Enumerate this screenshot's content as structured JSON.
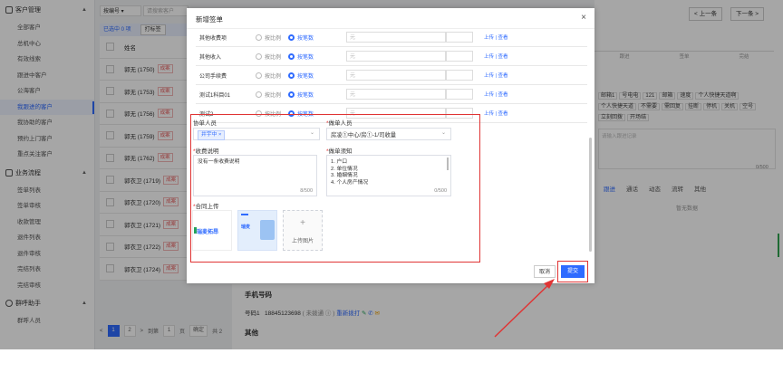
{
  "sidebar": {
    "group1": {
      "label": "客户管理"
    },
    "items1": [
      {
        "label": "全部客户"
      },
      {
        "label": "总机中心"
      },
      {
        "label": "有效线索"
      },
      {
        "label": "跟进中客户"
      },
      {
        "label": "公海客户"
      },
      {
        "label": "我跟进的客户"
      },
      {
        "label": "我协助的客户"
      },
      {
        "label": "预约上门客户"
      },
      {
        "label": "重点关注客户"
      }
    ],
    "group2": {
      "label": "业务流程"
    },
    "items2": [
      {
        "label": "签单列表"
      },
      {
        "label": "签单审核"
      },
      {
        "label": "收款管理"
      },
      {
        "label": "退件列表"
      },
      {
        "label": "退件审核"
      },
      {
        "label": "完结列表"
      },
      {
        "label": "完结审核"
      }
    ],
    "group3": {
      "label": "群呼助手"
    },
    "items3": [
      {
        "label": "群呼人员"
      }
    ]
  },
  "list": {
    "filter_select": "按编号 ▾",
    "filter_placeholder": "请搜索客户",
    "selected_text": "已选中 0 项",
    "tag_button": "打标签",
    "header": "姓名",
    "badge": "成案",
    "rows": [
      {
        "name": "郭无 (1750)"
      },
      {
        "name": "郭无 (1753)"
      },
      {
        "name": "郭无 (1756)"
      },
      {
        "name": "郭无 (1759)"
      },
      {
        "name": "郭无 (1762)"
      },
      {
        "name": "郭衣卫 (1719)"
      },
      {
        "name": "郭衣卫 (1720)"
      },
      {
        "name": "郭衣卫 (1721)"
      },
      {
        "name": "郭衣卫 (1722)"
      },
      {
        "name": "郭衣卫 (1724)"
      }
    ],
    "pager": {
      "prev": "<",
      "p1": "1",
      "p2": "2",
      "next": ">",
      "goto": "到第",
      "page_val": "1",
      "page_unit": "页",
      "confirm": "确定",
      "total": "共 2"
    }
  },
  "right": {
    "prev_btn": "< 上一条",
    "next_btn": "下一条 >",
    "steps": [
      "跟进",
      "签单",
      "完结"
    ],
    "quick_tags": [
      "邮箱1",
      "号电电",
      "121",
      "邮箱",
      "速度",
      "个人快捷天道啊",
      "个人快捷天道",
      "不需要",
      "需回复",
      "挂断",
      "停机",
      "关机",
      "空号",
      "立刻回拨",
      "开场结"
    ],
    "textarea_placeholder": "请输入跟进记录",
    "count": "0/500",
    "tabs": [
      "跟进",
      "通话",
      "动态",
      "流转",
      "其他"
    ],
    "nodata": "暂无数据"
  },
  "bottom": {
    "section_title": "手机号码",
    "phone_label": "号码1",
    "phone_value": "18845123698",
    "phone_note": "( 未拨通 ⓘ )",
    "phone_action": "重新拨打",
    "other_title": "其他"
  },
  "modal": {
    "title": "新增签单",
    "close": "×",
    "rows": [
      {
        "name": "其他收费项"
      },
      {
        "name": "其他收入"
      },
      {
        "name": "公司手续费"
      },
      {
        "name": "测试1科目01"
      },
      {
        "name": "测试2"
      }
    ],
    "radio_ratio": "按比例",
    "radio_amount": "按笔数",
    "input_placeholder": "元",
    "link_upload": "上传 | 查看",
    "helper_label": "协单人员",
    "helper_chip": "井宇中 ×",
    "signer_label": "做单人员",
    "signer_value": "房凌①中心/房①-1/司收量",
    "receipt_label": "收费说明",
    "receipt_text": "没有一条收费说明",
    "receipt_count": "8/500",
    "notice_label": "做单须知",
    "notice_lines": [
      "1. 户口",
      "2. 单位情况",
      "3. 婚姻情况",
      "4. 个人房产情况"
    ],
    "notice_count": "0/500",
    "contract_label": "合同上传",
    "upload_label": "上传图片",
    "thumb_logo": "瑞麦拓昂",
    "thumb2_text": "瑞麦",
    "cancel": "取消",
    "submit": "提交"
  }
}
